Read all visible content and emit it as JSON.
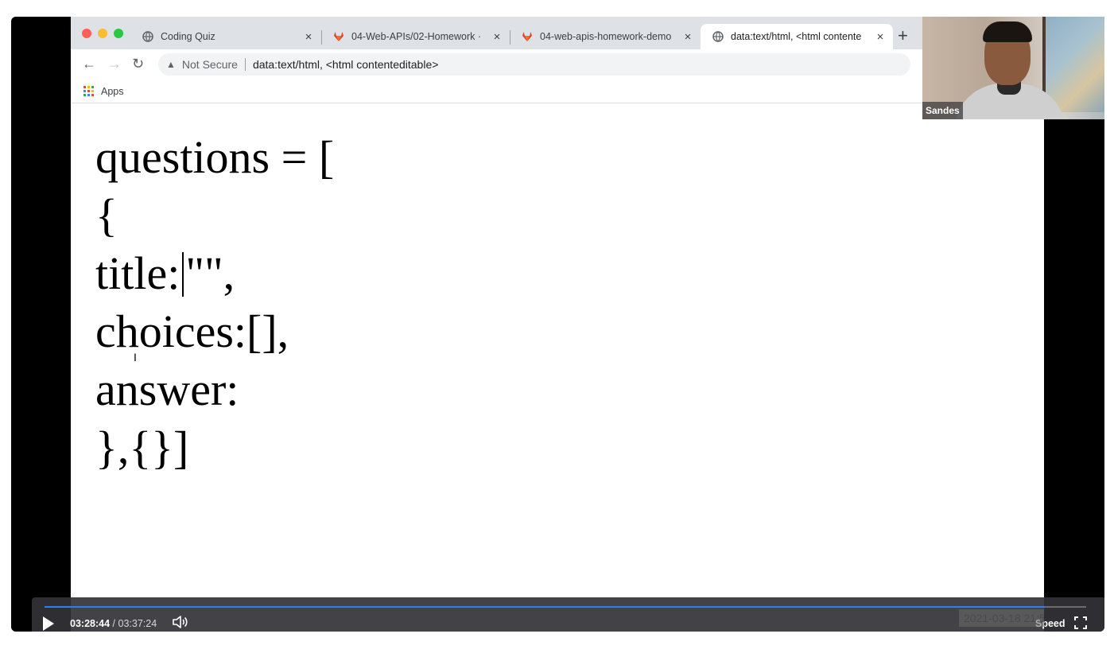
{
  "browser": {
    "tabs": [
      {
        "title": "Coding Quiz",
        "favicon": "globe-icon"
      },
      {
        "title": "04-Web-APIs/02-Homework ·",
        "favicon": "gitlab-icon"
      },
      {
        "title": "04-web-apis-homework-demo",
        "favicon": "gitlab-icon"
      },
      {
        "title": "data:text/html, <html contente",
        "favicon": "globe-icon"
      }
    ],
    "address": {
      "security_label": "Not Secure",
      "url": "data:text/html, <html contenteditable>"
    },
    "bookmarks": {
      "apps_label": "Apps"
    }
  },
  "page": {
    "lines": [
      "questions = [",
      "{",
      "\"\",",
      "choices:[],",
      "answer:",
      "},{}]"
    ],
    "title_key": "title:"
  },
  "webcam": {
    "participant_name": "Sandes"
  },
  "player": {
    "current_time": "03:28:44",
    "separator": "/",
    "duration": "03:37:24",
    "progress_fraction": 0.96,
    "speed_label": "Speed",
    "recording_timestamp": "2021-03-18 21:54:48"
  },
  "colors": {
    "progress": "#2f7fe8",
    "tabstrip": "#dee1e6",
    "close_red": "#ff5f57",
    "minimize_yellow": "#febc2e",
    "maximize_green": "#28c840",
    "gitlab_orange": "#e2432a"
  }
}
